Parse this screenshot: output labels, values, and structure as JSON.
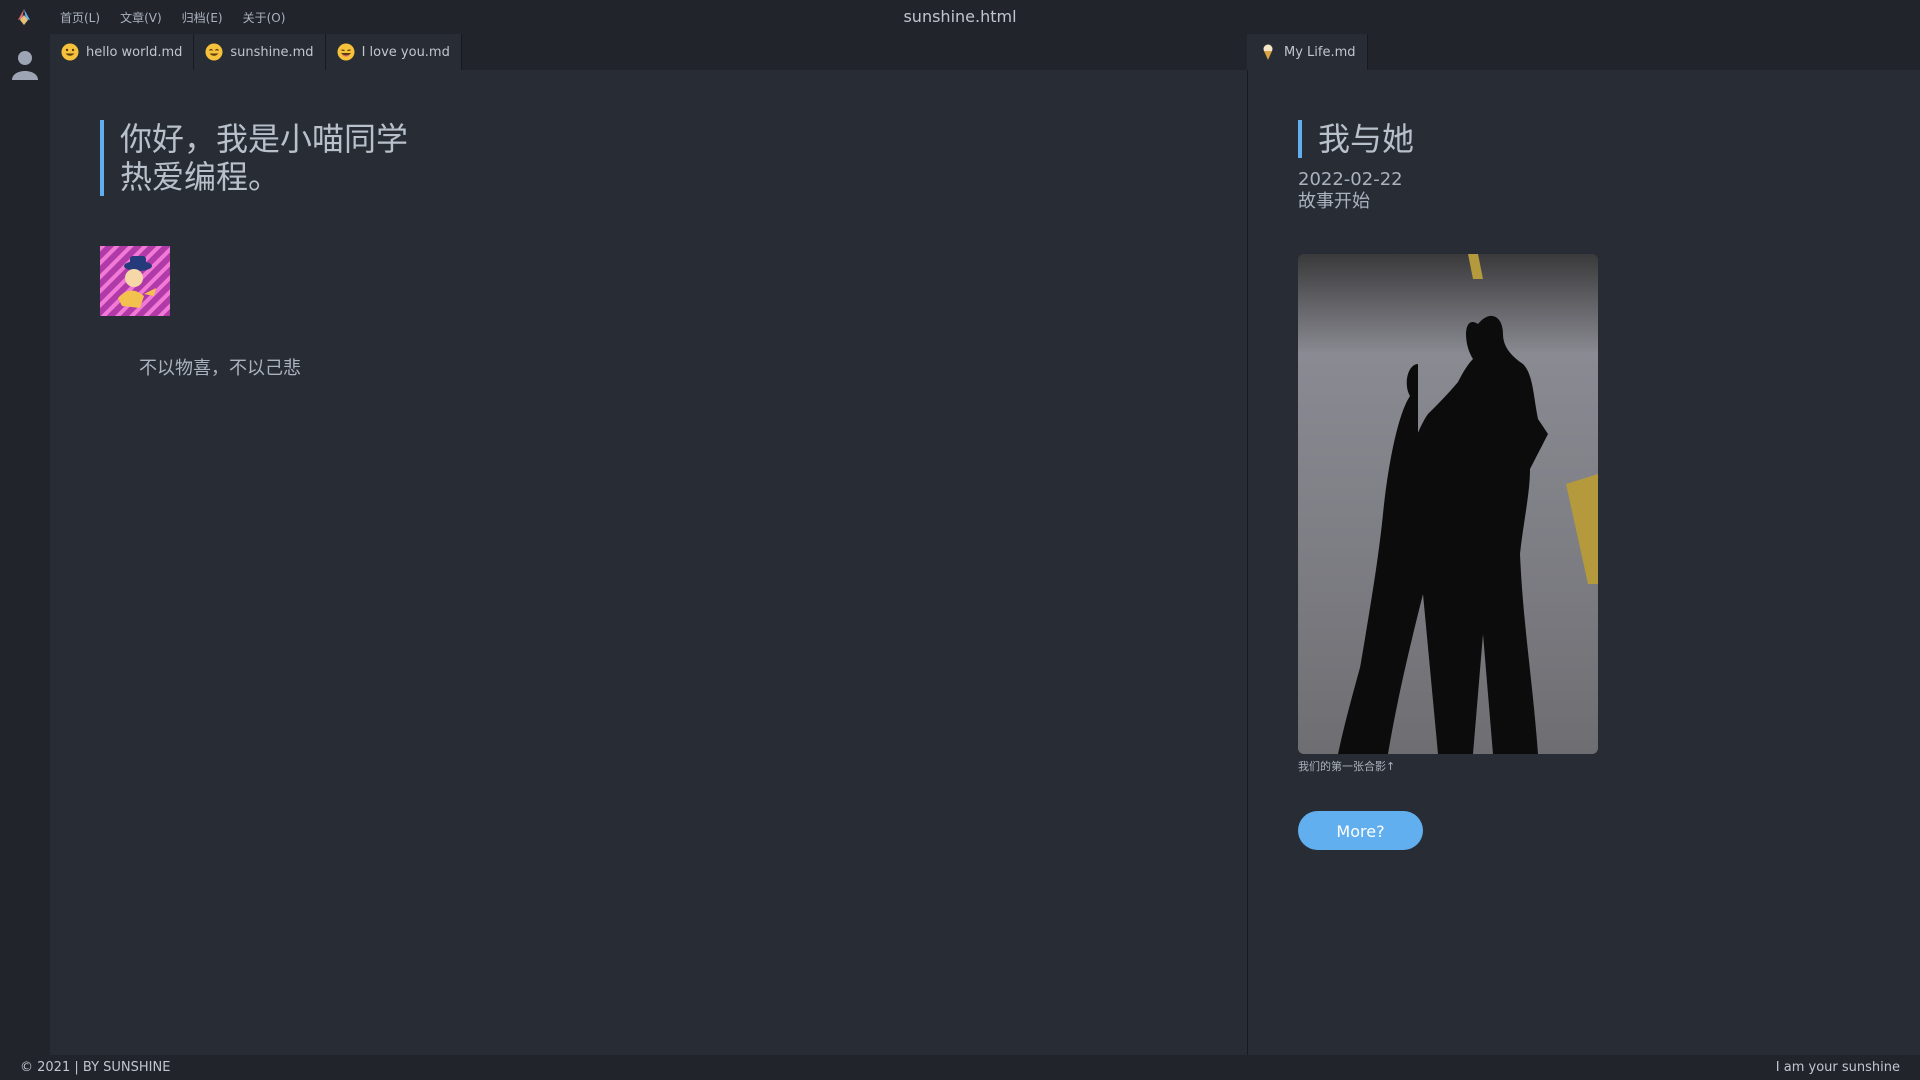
{
  "window": {
    "title": "sunshine.html"
  },
  "menu": {
    "items": [
      "首页(L)",
      "文章(V)",
      "归档(E)",
      "关于(O)"
    ]
  },
  "tabs_left": [
    {
      "label": "hello world.md",
      "icon": "emoji-icon"
    },
    {
      "label": "sunshine.md",
      "icon": "emoji-icon"
    },
    {
      "label": "I love you.md",
      "icon": "emoji-icon"
    }
  ],
  "tabs_right": [
    {
      "label": "My Life.md",
      "icon": "icecream-icon"
    }
  ],
  "left_pane": {
    "heading_line1": "你好，我是小喵同学",
    "heading_line2": "热爱编程。",
    "motto": "不以物喜，不以己悲"
  },
  "right_pane": {
    "heading": "我与她",
    "date": "2022-02-22",
    "subtitle": "故事开始",
    "photo_caption": "我们的第一张合影↑",
    "more_button": "More?"
  },
  "statusbar": {
    "left": "© 2021 | BY SUNSHINE",
    "right": "I am your sunshine"
  },
  "colors": {
    "background": "#282c34",
    "chrome": "#21252b",
    "accent": "#61afef"
  }
}
